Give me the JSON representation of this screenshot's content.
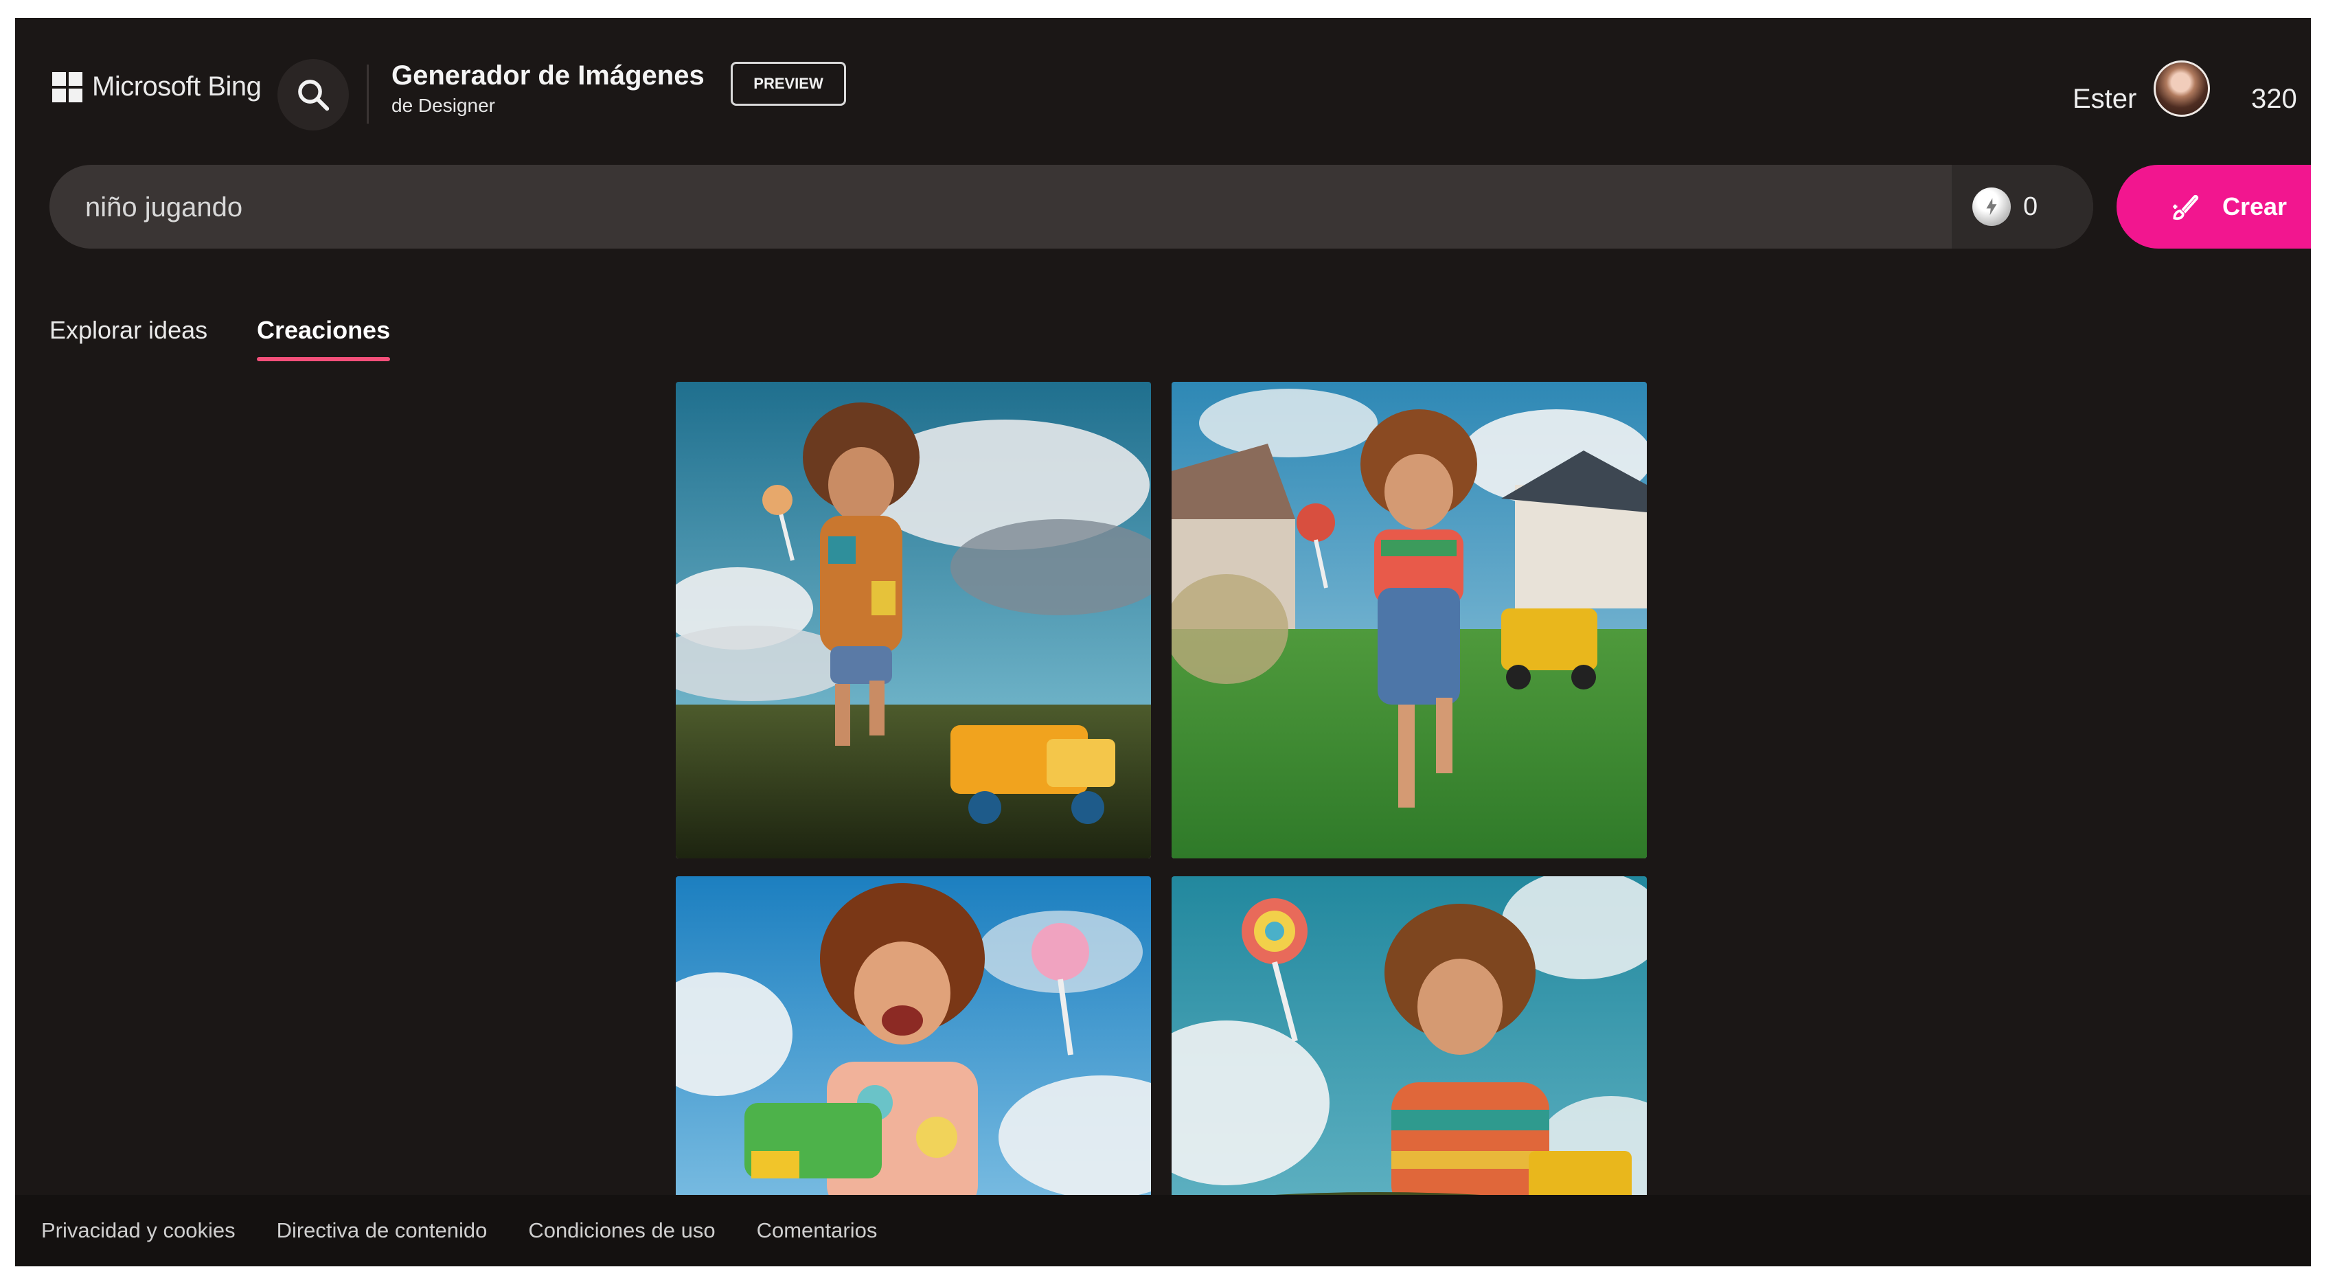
{
  "header": {
    "brand": "Microsoft Bing",
    "title": "Generador de Imágenes",
    "subtitle": "de Designer",
    "badge": "PREVIEW",
    "user_name": "Ester",
    "coins": "320"
  },
  "search": {
    "value": "niño jugando",
    "boost_count": "0",
    "create_label": "Crear"
  },
  "tabs": [
    {
      "label": "Explorar ideas",
      "active": false
    },
    {
      "label": "Creaciones",
      "active": true
    }
  ],
  "icons": {
    "logo": "microsoft-logo-icon",
    "search": "search-icon",
    "boost": "boost-icon",
    "create": "brush-icon"
  },
  "colors": {
    "background": "#1b1716",
    "accent": "#f2168f",
    "tab_underline": "#f4507a"
  },
  "footer": {
    "links": [
      "Privacidad y cookies",
      "Directiva de contenido",
      "Condiciones de uso",
      "Comentarios"
    ]
  }
}
